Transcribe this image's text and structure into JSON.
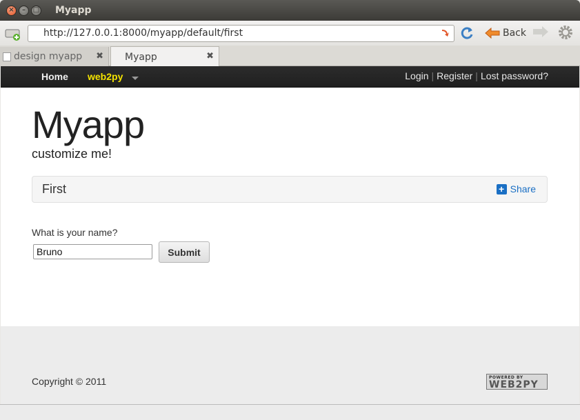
{
  "window": {
    "title": "Myapp"
  },
  "toolbar": {
    "url": "http://127.0.0.1:8000/myapp/default/first",
    "back_label": "Back"
  },
  "tabs": [
    {
      "label": "design myapp"
    },
    {
      "label": "Myapp"
    }
  ],
  "navbar": {
    "home": "Home",
    "brand": "web2py",
    "login": "Login",
    "register": "Register",
    "lost_password": "Lost password?",
    "separator": "|"
  },
  "header": {
    "title": "Myapp",
    "subtitle": "customize me!"
  },
  "page": {
    "heading": "First",
    "share_label": "Share"
  },
  "form": {
    "question": "What is your name?",
    "name_value": "Bruno",
    "submit_label": "Submit"
  },
  "footer": {
    "copyright": "Copyright © 2011",
    "powered_small": "POWERED BY",
    "powered_big": "WEB2PY"
  },
  "colors": {
    "brand": "#f5e400",
    "link": "#1a6fc4",
    "navbar": "#222222"
  }
}
